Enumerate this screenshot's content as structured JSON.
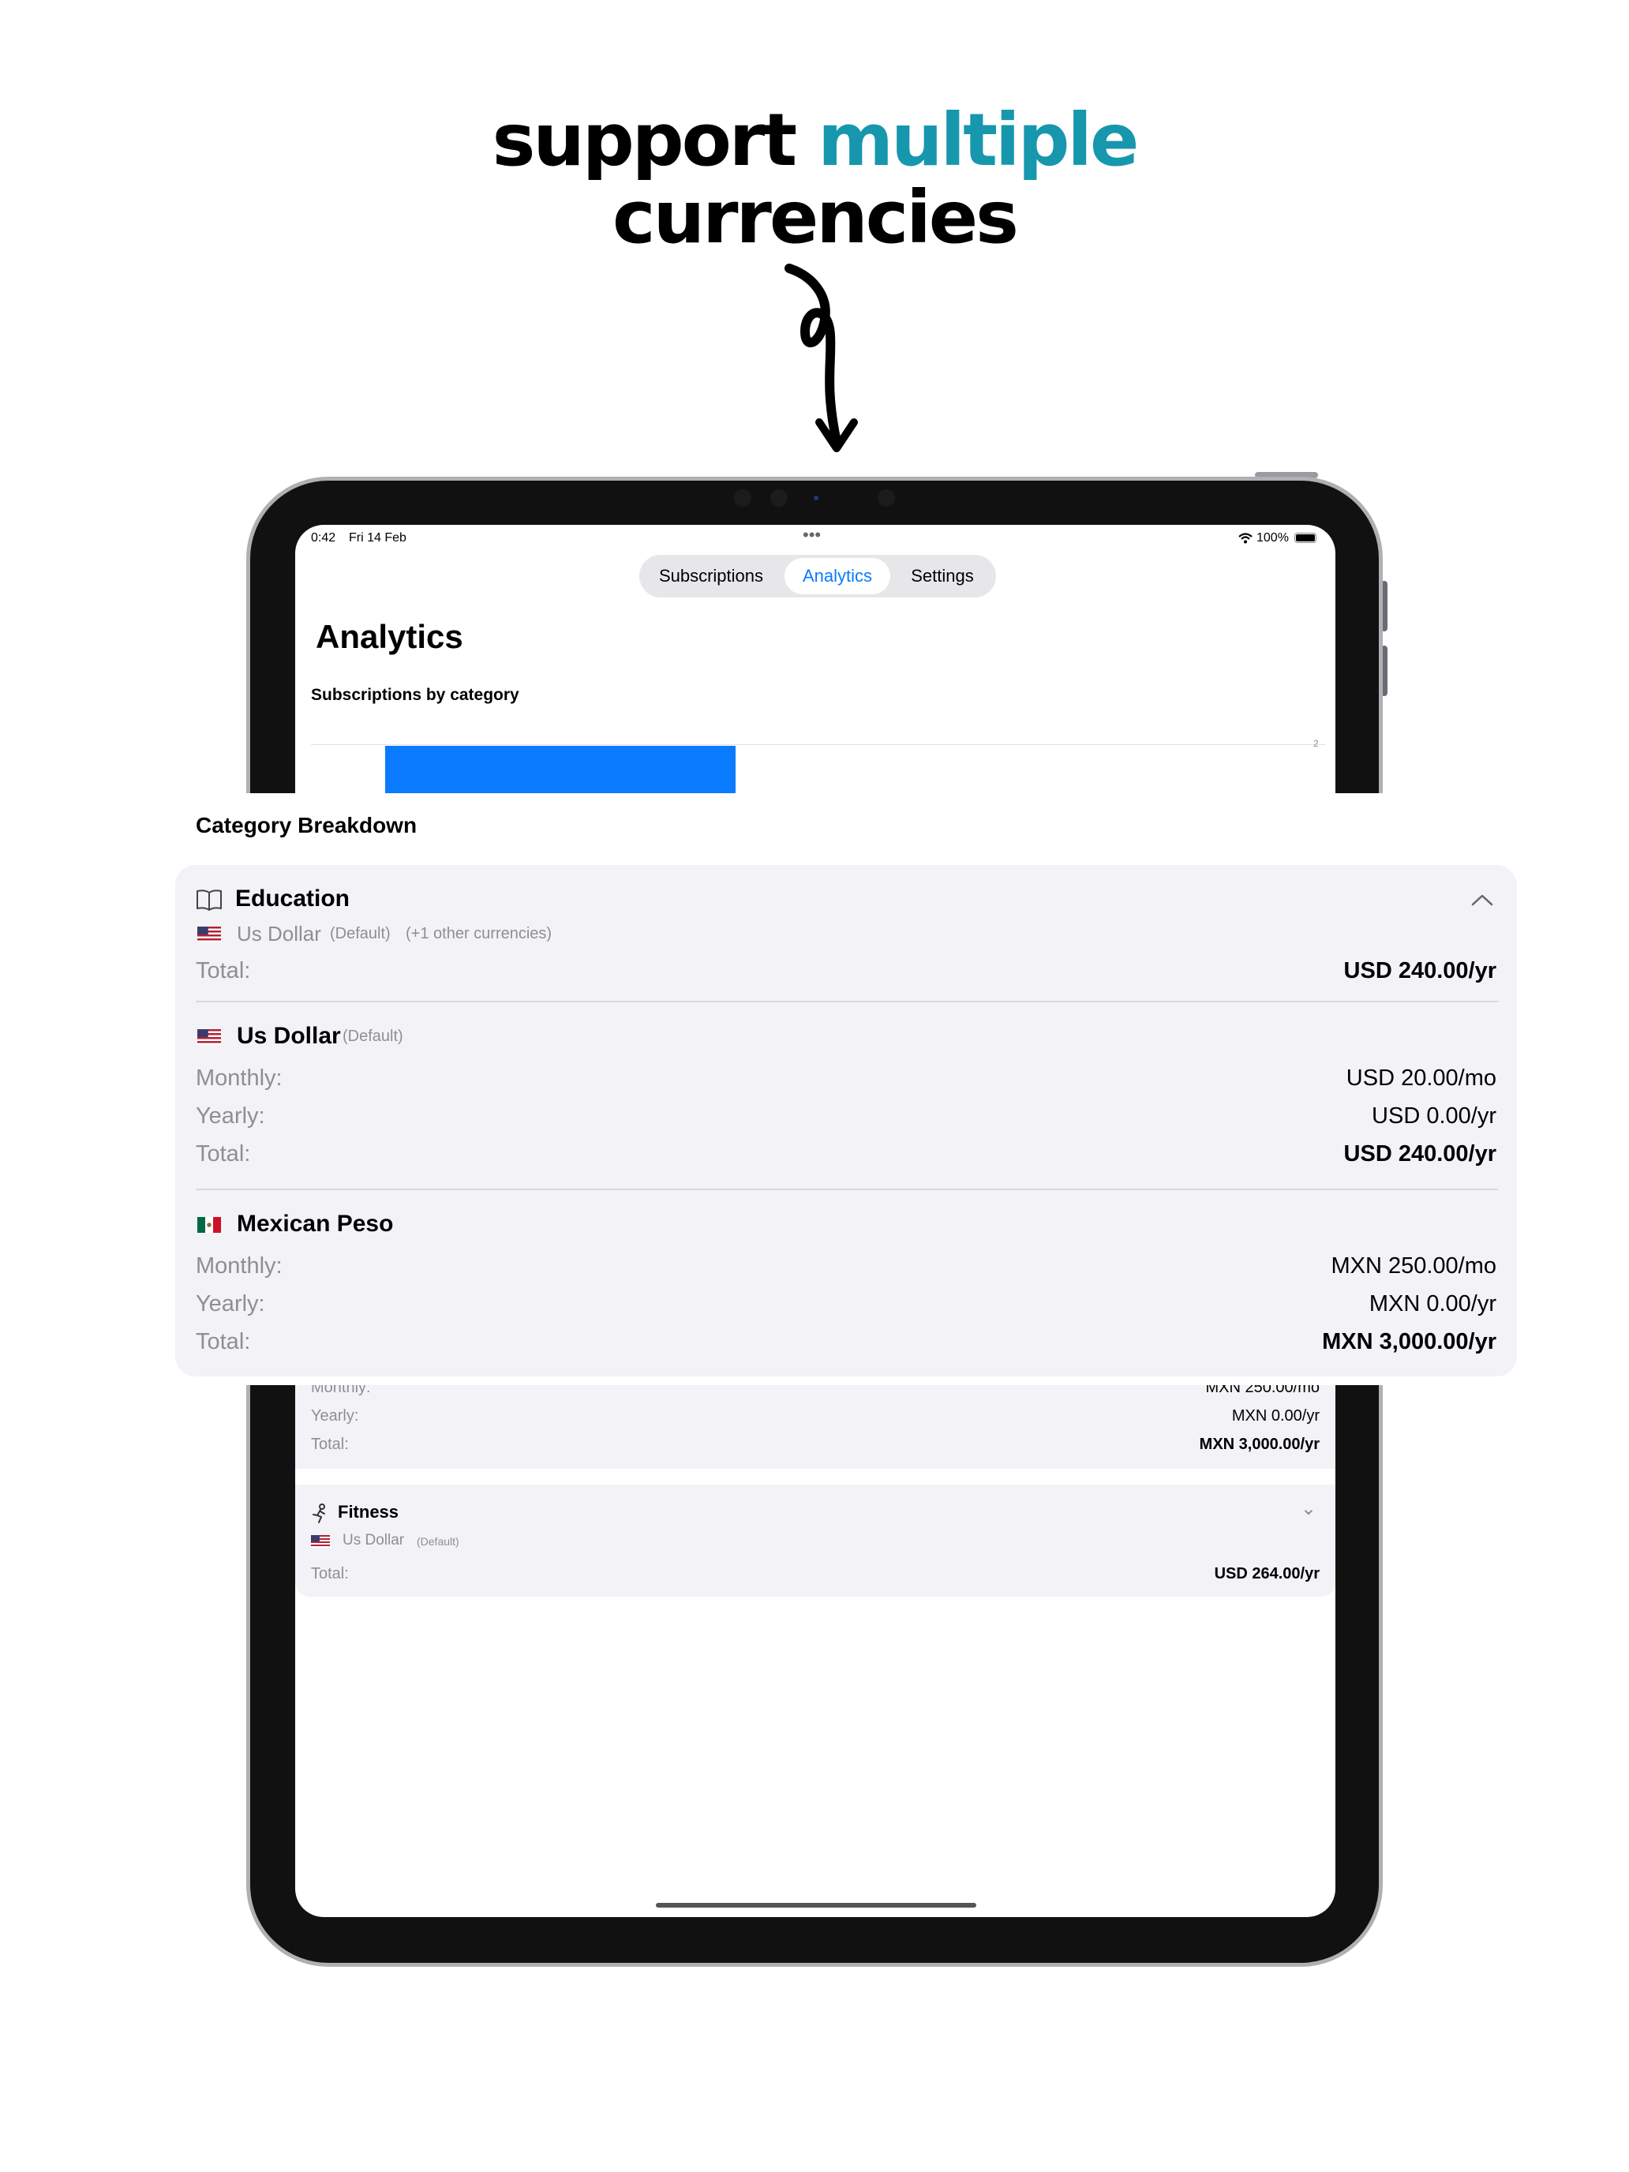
{
  "headline": {
    "line1_part1": "support ",
    "line1_accent": "multiple",
    "line2": "currencies",
    "accent_color": "#1697ad"
  },
  "status_bar": {
    "time": "0:42",
    "date": "Fri 14 Feb",
    "dots": "•••",
    "battery": "100%"
  },
  "tabs": [
    {
      "label": "Subscriptions",
      "selected": false
    },
    {
      "label": "Analytics",
      "selected": true
    },
    {
      "label": "Settings",
      "selected": false
    }
  ],
  "analytics": {
    "title": "Analytics",
    "chart_title": "Subscriptions by category",
    "chart_tick": "2",
    "bar_color": "#0a7aff"
  },
  "background_list": {
    "partial_monthly_label": "Monthly:",
    "partial_monthly_value": "MXN 250.00/mo",
    "yearly_label": "Yearly:",
    "yearly_value": "MXN 0.00/yr",
    "total_label": "Total:",
    "total_value": "MXN 3,000.00/yr",
    "fitness": {
      "name": "Fitness",
      "icon": "running-icon",
      "currency": "Us Dollar",
      "default_tag": "(Default)",
      "total_label": "Total:",
      "total_value": "USD 264.00/yr"
    }
  },
  "breakdown": {
    "title": "Category Breakdown",
    "category": {
      "name": "Education",
      "icon": "book-icon",
      "currency": "Us Dollar",
      "default_tag": "(Default)",
      "other_tag": "(+1 other currencies)",
      "total_label": "Total:",
      "total_value": "USD 240.00/yr"
    },
    "currencies": [
      {
        "name": "Us Dollar",
        "default_tag": "(Default)",
        "flag": "us-flag",
        "monthly_label": "Monthly:",
        "monthly_value": "USD 20.00/mo",
        "yearly_label": "Yearly:",
        "yearly_value": "USD 0.00/yr",
        "total_label": "Total:",
        "total_value": "USD 240.00/yr"
      },
      {
        "name": "Mexican Peso",
        "default_tag": "",
        "flag": "mx-flag",
        "monthly_label": "Monthly:",
        "monthly_value": "MXN 250.00/mo",
        "yearly_label": "Yearly:",
        "yearly_value": "MXN 0.00/yr",
        "total_label": "Total:",
        "total_value": "MXN 3,000.00/yr"
      }
    ]
  }
}
